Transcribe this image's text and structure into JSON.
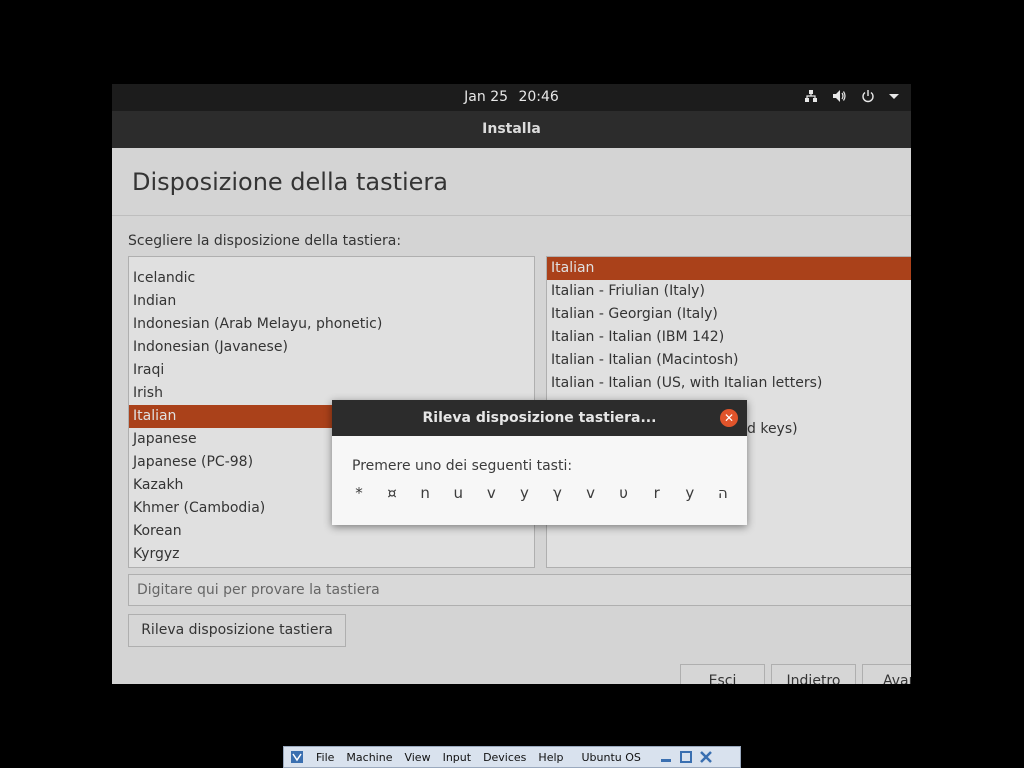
{
  "topbar": {
    "date": "Jan 25",
    "time": "20:46",
    "icons": [
      "network-icon",
      "volume-icon",
      "power-icon",
      "dropdown-arrow-icon"
    ]
  },
  "window": {
    "title": "Installa"
  },
  "page": {
    "heading": "Disposizione della tastiera",
    "prompt": "Scegliere la disposizione della tastiera:"
  },
  "layouts": [
    "Icelandic",
    "Indian",
    "Indonesian (Arab Melayu, phonetic)",
    "Indonesian (Javanese)",
    "Iraqi",
    "Irish",
    "Italian",
    "Japanese",
    "Japanese (PC-98)",
    "Kazakh",
    "Khmer (Cambodia)",
    "Korean",
    "Kyrgyz"
  ],
  "selected_layout": "Italian",
  "variants": [
    "Italian",
    "Italian - Friulian (Italy)",
    "Italian - Georgian (Italy)",
    "Italian - Italian (IBM 142)",
    "Italian - Italian (Macintosh)",
    "Italian - Italian (US, with Italian letters)"
  ],
  "hidden_variant_fragment": "d keys)",
  "selected_variant": "Italian",
  "test_input": {
    "placeholder": "Digitare qui per provare la tastiera"
  },
  "buttons": {
    "detect": "Rileva disposizione tastiera",
    "quit": "Esci",
    "back": "Indietro",
    "forward": "Avan"
  },
  "dialog": {
    "title": "Rileva disposizione tastiera...",
    "message": "Premere uno dei seguenti tasti:",
    "keys": [
      "*",
      "¤",
      "n",
      "u",
      "v",
      "y",
      "γ",
      "v",
      "υ",
      "r",
      "y",
      "ה"
    ]
  },
  "vbox_menu": {
    "items": [
      "File",
      "Machine",
      "View",
      "Input",
      "Devices",
      "Help"
    ],
    "host": "Ubuntu OS"
  },
  "colors": {
    "accent": "#c24a1e",
    "close": "#e0542b",
    "dark_bar": "#1c1c1c"
  }
}
